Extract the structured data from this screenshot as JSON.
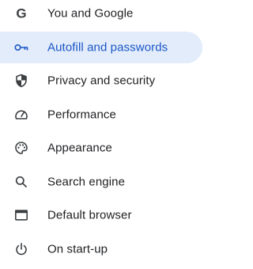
{
  "colors": {
    "active_background": "#e2ecfb",
    "active_text": "#1a56c5",
    "text": "#202124",
    "icon": "#3c4043"
  },
  "sidebar": {
    "items": [
      {
        "label": "You and Google",
        "icon": "google-g-icon",
        "active": false
      },
      {
        "label": "Autofill and passwords",
        "icon": "key-icon",
        "active": true
      },
      {
        "label": "Privacy and security",
        "icon": "shield-icon",
        "active": false
      },
      {
        "label": "Performance",
        "icon": "speedometer-icon",
        "active": false
      },
      {
        "label": "Appearance",
        "icon": "palette-icon",
        "active": false
      },
      {
        "label": "Search engine",
        "icon": "search-icon",
        "active": false
      },
      {
        "label": "Default browser",
        "icon": "browser-window-icon",
        "active": false
      },
      {
        "label": "On start-up",
        "icon": "power-icon",
        "active": false
      }
    ]
  }
}
